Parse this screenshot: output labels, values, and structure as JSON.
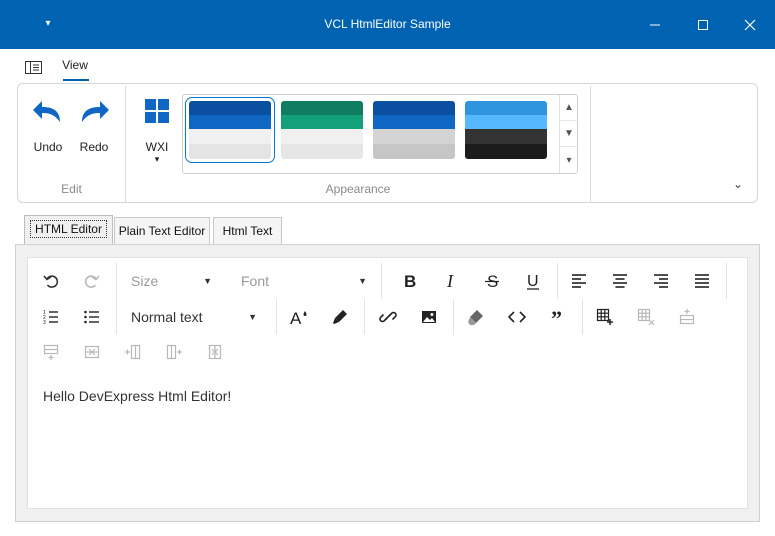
{
  "window": {
    "title": "VCL HtmlEditor Sample",
    "qat_icon": "chevron-down-icon",
    "minimize_icon": "minimize-icon",
    "maximize_icon": "maximize-icon",
    "close_icon": "close-icon"
  },
  "ribbon": {
    "app_button_icon": "app-menu-icon",
    "tabs": [
      {
        "label": "View",
        "active": true
      }
    ],
    "groups": {
      "edit": {
        "label": "Edit",
        "undo": "Undo",
        "redo": "Redo"
      },
      "appearance": {
        "label": "Appearance",
        "wxi": "WXI",
        "swatches": [
          {
            "name": "blue",
            "selected": true,
            "colors": [
              "#0a4fa0",
              "#0f66c3",
              "#f0f0f0",
              "#e4e4e4"
            ]
          },
          {
            "name": "teal",
            "selected": false,
            "colors": [
              "#0e7d60",
              "#14a07a",
              "#f0f0f0",
              "#e6e6e6"
            ]
          },
          {
            "name": "blue-gray",
            "selected": false,
            "colors": [
              "#0a4fa0",
              "#0f66c3",
              "#d4d4d4",
              "#c6c6c6"
            ]
          },
          {
            "name": "dark",
            "selected": false,
            "colors": [
              "#2f95de",
              "#56b9ff",
              "#333333",
              "#1c1c1c"
            ]
          }
        ]
      }
    },
    "accent": "#0063b1"
  },
  "page_tabs": [
    {
      "label": "HTML Editor",
      "active": true
    },
    {
      "label": "Plain Text Editor",
      "active": false
    },
    {
      "label": "Html Text",
      "active": false
    }
  ],
  "toolbar": {
    "size_placeholder": "Size",
    "font_placeholder": "Font",
    "paragraph_style": "Normal text"
  },
  "editor": {
    "content": "Hello DevExpress Html Editor!"
  }
}
